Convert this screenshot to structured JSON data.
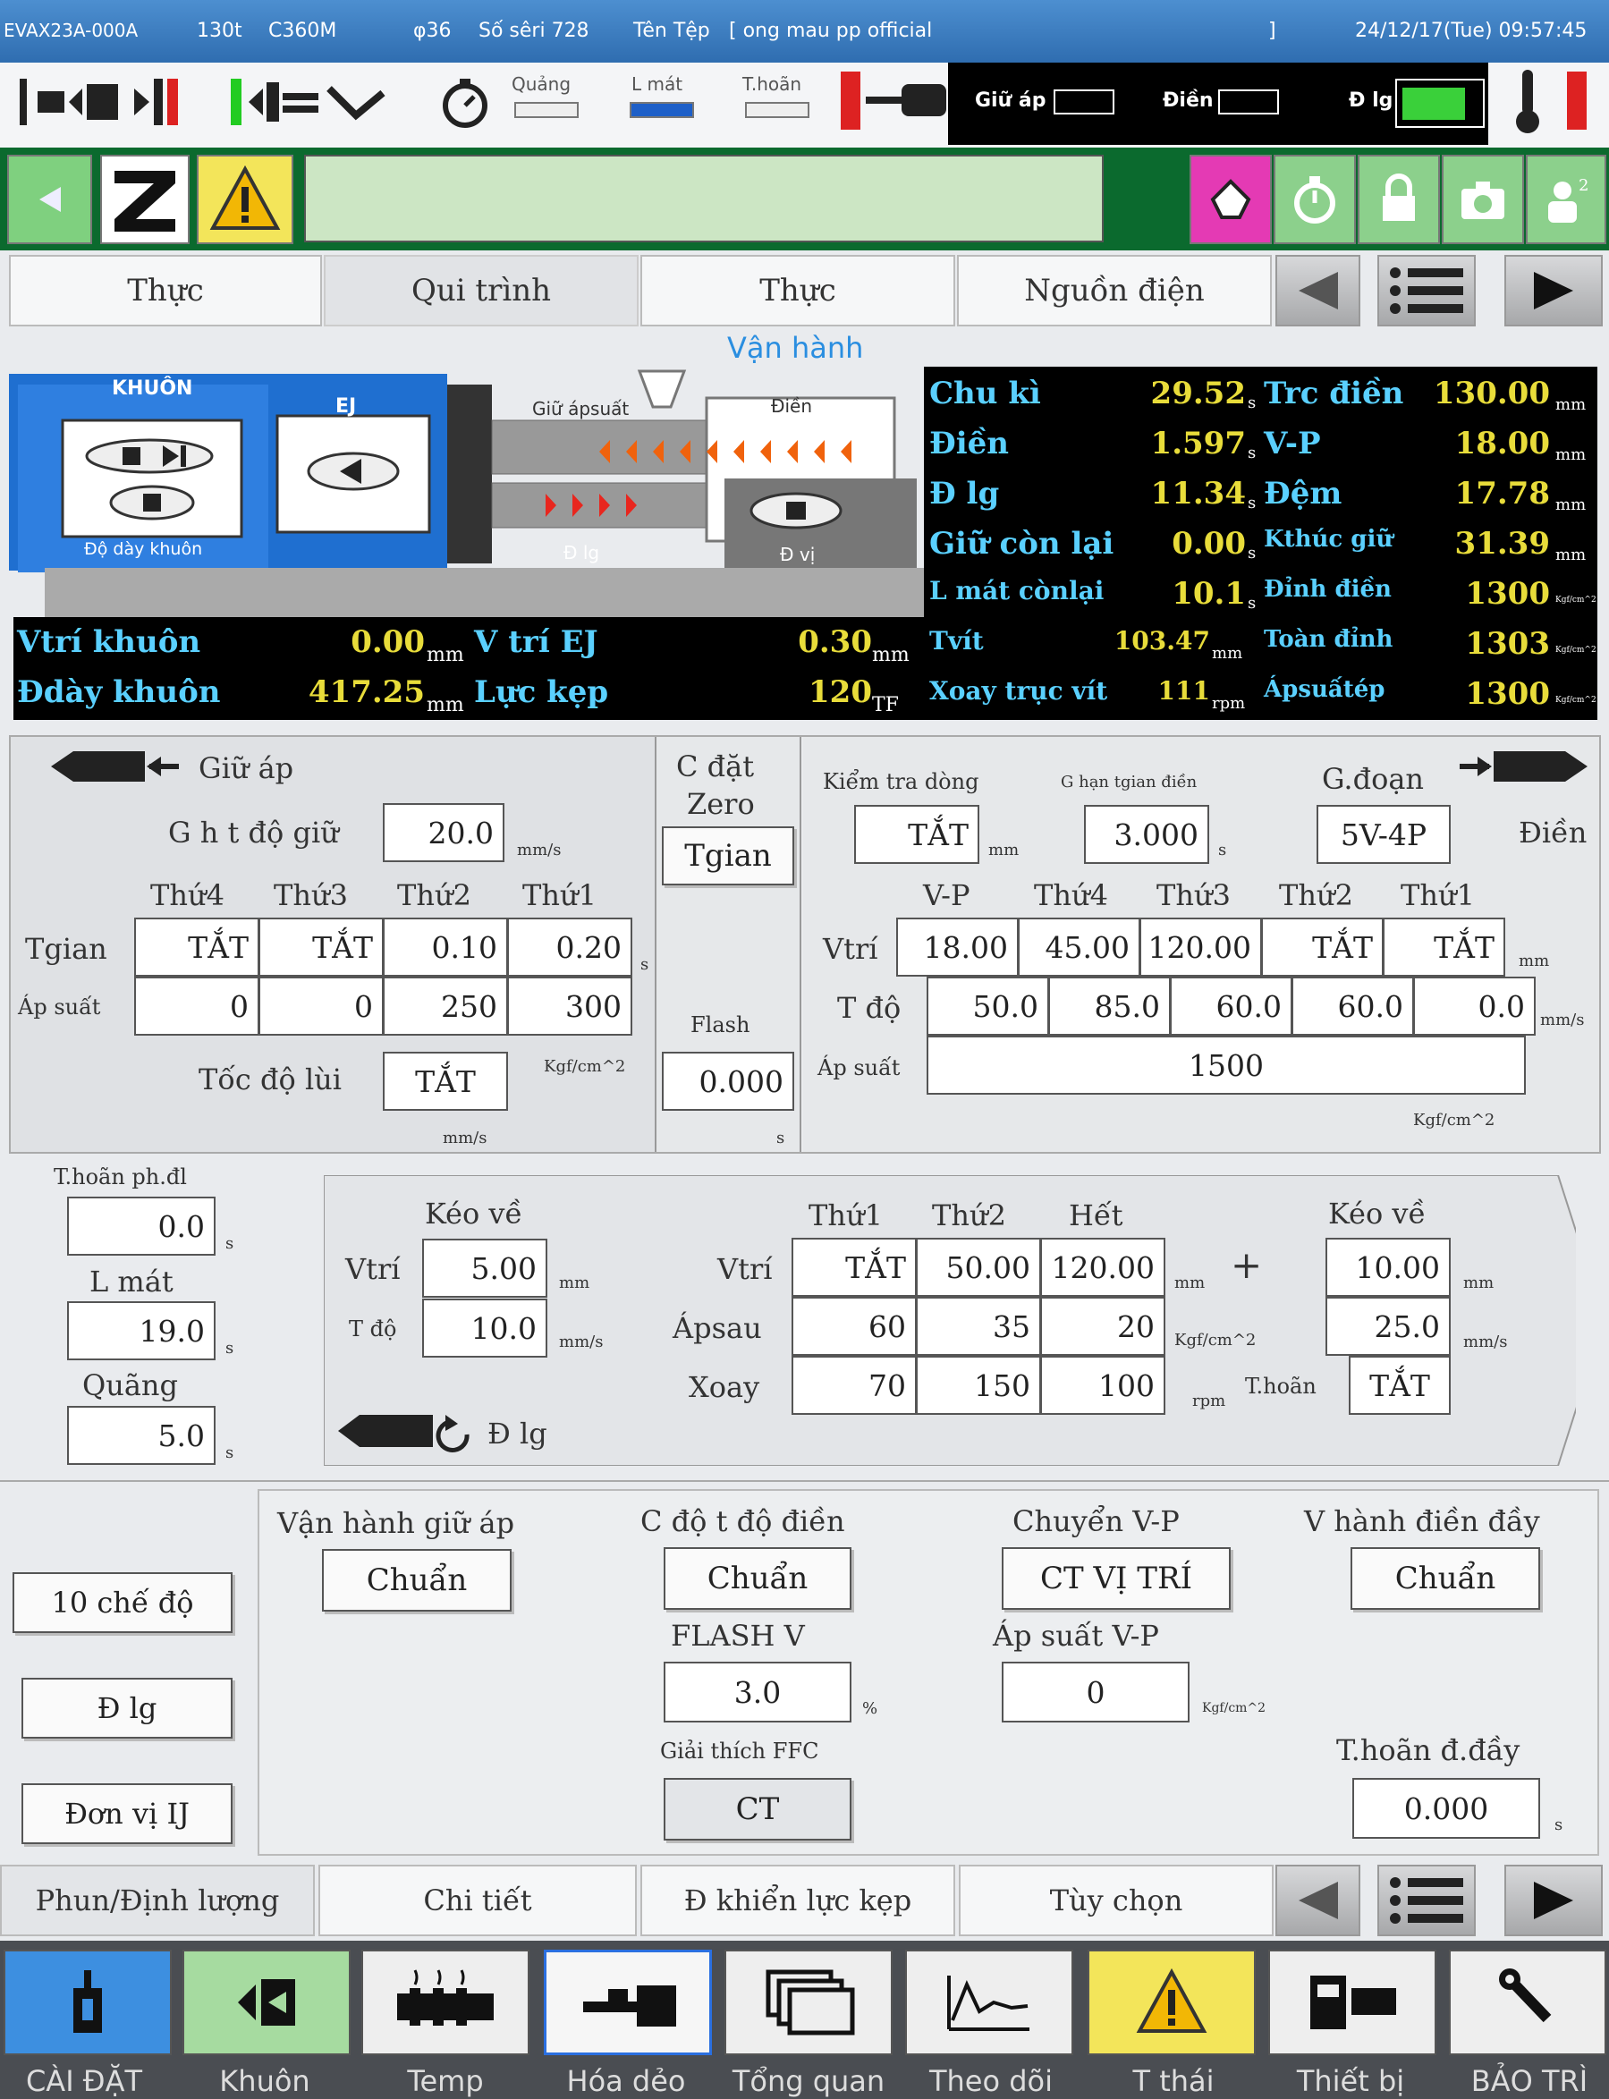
{
  "topbar": {
    "machine": "EVAX23A-000A",
    "tonnage": "130t",
    "controller": "C360M",
    "screw": "φ36",
    "serial": "Số sêri 728",
    "file_label": "Tên Tệp",
    "file_name": "[ ong mau pp official",
    "file_end": "]",
    "datetime": "24/12/17(Tue) 09:57:45"
  },
  "status": {
    "quang": "Quảng",
    "lmat": "L mát",
    "thoan": "T.hoãn",
    "giu_ap": "Giữ áp",
    "dien": "Điền",
    "d_lg": "Đ lg"
  },
  "tabs_top": [
    "Thực",
    "Qui trình",
    "Thực",
    "Nguồn điện"
  ],
  "van_hanh": "Vận hành",
  "machine_diagram": {
    "khuon": "KHUÔN",
    "ej": "EJ",
    "do_day_khuon": "Độ dày khuôn",
    "giu_ap_suat": "Giữ ápsuất",
    "dien": "Điền",
    "d_lg": "Đ lg",
    "d_vi": "Đ vị"
  },
  "monitor_right": [
    {
      "l1": "Chu kì",
      "v1": "29.52",
      "u1": "s",
      "l2": "Trc điền",
      "v2": "130.00",
      "u2": "mm"
    },
    {
      "l1": "Điền",
      "v1": "1.597",
      "u1": "s",
      "l2": "V-P",
      "v2": "18.00",
      "u2": "mm"
    },
    {
      "l1": "Đ lg",
      "v1": "11.34",
      "u1": "s",
      "l2": "Đệm",
      "v2": "17.78",
      "u2": "mm"
    },
    {
      "l1": "Giữ còn lại",
      "v1": "0.00",
      "u1": "s",
      "l2": "Kthúc giữ",
      "v2": "31.39",
      "u2": "mm"
    },
    {
      "l1": "L mát cònlại",
      "v1": "10.1",
      "u1": "s",
      "l2": "Đỉnh điền",
      "v2": "1300",
      "u2": "Kgf/cm^2"
    },
    {
      "l1": "Tvít",
      "v1": "103.47",
      "u1": "mm",
      "l2": "Toàn đỉnh",
      "v2": "1303",
      "u2": "Kgf/cm^2"
    },
    {
      "l1": "Xoay trục vít",
      "v1": "111",
      "u1": "rpm",
      "l2": "Ápsuấtép",
      "v2": "1300",
      "u2": "Kgf/cm^2"
    }
  ],
  "monitor_left": [
    {
      "l1": "Vtrí khuôn",
      "v1": "0.00",
      "u1": "mm",
      "l2": "V trí EJ",
      "v2": "0.30",
      "u2": "mm"
    },
    {
      "l1": "Đdày khuôn",
      "v1": "417.25",
      "u1": "mm",
      "l2": "Lực kẹp",
      "v2": "120",
      "u2": "TF"
    }
  ],
  "hold": {
    "title": "Giữ áp",
    "speed_label": "G h t độ giữ",
    "speed": "20.0",
    "speed_unit": "mm/s",
    "cols": [
      "Thứ4",
      "Thứ3",
      "Thứ2",
      "Thứ1"
    ],
    "row_time": "Tgian",
    "times": [
      "TẮT",
      "TẮT",
      "0.10",
      "0.20"
    ],
    "time_unit": "s",
    "row_press": "Áp suất",
    "press": [
      "0",
      "0",
      "250",
      "300"
    ],
    "press_unit": "Kgf/cm^2",
    "back_label": "Tốc độ lùi",
    "back": "TẮT",
    "back_unit": "mm/s"
  },
  "zero": {
    "title1": "C đặt",
    "title2": "Zero",
    "mode": "Tgian",
    "flash_label": "Flash",
    "flash": "0.000",
    "flash_unit": "s"
  },
  "inject": {
    "check_label": "Kiểm tra dòng",
    "check": "TẮT",
    "check_unit": "mm",
    "limit_label": "G hạn tgian điền",
    "limit": "3.000",
    "limit_unit": "s",
    "stage_label": "G.đoạn",
    "stage": "5V-4P",
    "fill_label": "Điền",
    "cols": [
      "V-P",
      "Thứ4",
      "Thứ3",
      "Thứ2",
      "Thứ1"
    ],
    "row_pos": "Vtrí",
    "pos": [
      "18.00",
      "45.00",
      "120.00",
      "TẮT",
      "TẮT"
    ],
    "pos_unit": "mm",
    "row_speed": "T độ",
    "speed": [
      "50.0",
      "85.0",
      "60.0",
      "60.0",
      "0.0"
    ],
    "speed_unit": "mm/s",
    "row_press": "Áp suất",
    "press": "1500",
    "press_unit": "Kgf/cm^2"
  },
  "left_timers": {
    "delay_label": "T.hoãn ph.đl",
    "delay": "0.0",
    "cool_label": "L mát",
    "cool": "19.0",
    "interval_label": "Quãng",
    "interval": "5.0",
    "unit": "s"
  },
  "charge": {
    "suck_label": "Kéo về",
    "row_pos": "Vtrí",
    "suck_pos": "5.00",
    "pos_unit": "mm",
    "row_speed": "T độ",
    "suck_speed": "10.0",
    "speed_unit": "mm/s",
    "cols": [
      "Thứ1",
      "Thứ2",
      "Hết"
    ],
    "pos": [
      "TẮT",
      "50.00",
      "120.00"
    ],
    "row_back": "Ápsau",
    "back": [
      "60",
      "35",
      "20"
    ],
    "back_unit": "Kgf/cm^2",
    "row_rot": "Xoay",
    "rot": [
      "70",
      "150",
      "100"
    ],
    "rot_unit": "rpm",
    "plus": "+",
    "suck2_label": "Kéo về",
    "suck2_pos": "10.00",
    "suck2_speed": "25.0",
    "delay_label": "T.hoãn",
    "delay": "TẮT",
    "icon_label": "Đ lg"
  },
  "side_buttons": [
    "10 chế độ",
    "Đ lg",
    "Đơn vị IJ"
  ],
  "options": {
    "hold_mode_label": "Vận hành giữ áp",
    "hold_mode": "Chuẩn",
    "fill_speed_label": "C độ t độ điền",
    "fill_speed": "Chuẩn",
    "vp_label": "Chuyển V-P",
    "vp": "CT VỊ TRÍ",
    "pack_label": "V hành điền đầy",
    "pack": "Chuẩn",
    "flashv_label": "FLASH V",
    "flashv": "3.0",
    "flashv_unit": "%",
    "vp_press_label": "Áp suất V-P",
    "vp_press": "0",
    "vp_press_unit": "Kgf/cm^2",
    "ffc_label": "Giải thích FFC",
    "ffc": "CT",
    "pack_delay_label": "T.hoãn đ.đầy",
    "pack_delay": "0.000",
    "pack_delay_unit": "s"
  },
  "tabs_bottom": [
    "Phun/Định lượng",
    "Chi tiết",
    "Đ khiển lực kẹp",
    "Tùy chọn"
  ],
  "bottom_nav": [
    "CÀI ĐẶT",
    "Khuôn",
    "Temp",
    "Hóa dẻo",
    "Tổng quan",
    "Theo dõi",
    "T thái",
    "Thiết bị",
    "BẢO TRÌ"
  ],
  "colors": {
    "topbar": "#2f6db0",
    "toolbar": "#0b6a2e",
    "monitor_bg": "#000000",
    "value": "#e8dc3a",
    "label": "#5ad0ff",
    "machine_blue": "#1f6fd0"
  }
}
